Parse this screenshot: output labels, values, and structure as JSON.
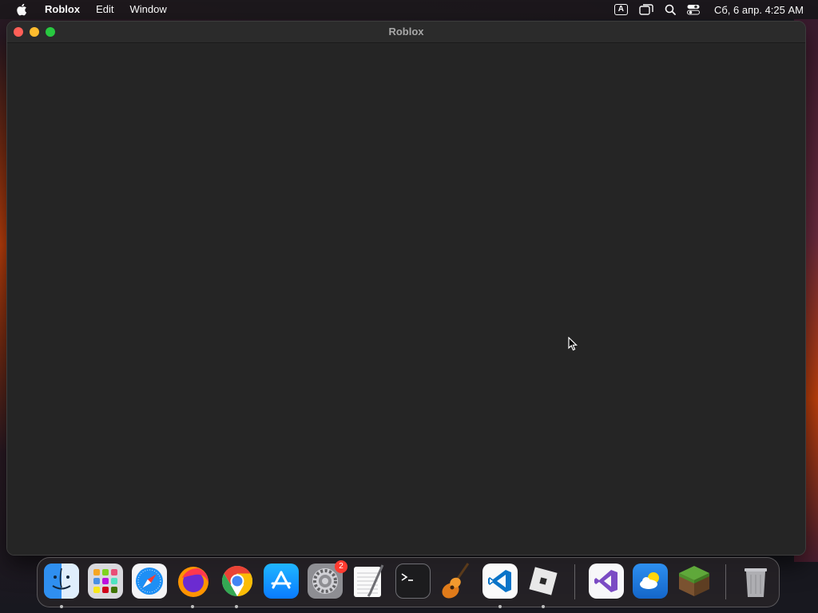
{
  "menubar": {
    "app_name": "Roblox",
    "items": [
      "Edit",
      "Window"
    ],
    "input_source": "A",
    "clock": "Сб, 6 апр.  4:25 AM"
  },
  "window": {
    "title": "Roblox"
  },
  "dock": {
    "system_preferences_badge": "2",
    "apps": [
      {
        "name": "finder",
        "icon": "finder-icon",
        "running": true
      },
      {
        "name": "launchpad",
        "icon": "launchpad-icon",
        "running": false
      },
      {
        "name": "safari",
        "icon": "safari-icon",
        "running": false
      },
      {
        "name": "firefox",
        "icon": "firefox-icon",
        "running": true
      },
      {
        "name": "chrome",
        "icon": "chrome-icon",
        "running": true
      },
      {
        "name": "app-store",
        "icon": "app-store-icon",
        "running": false
      },
      {
        "name": "system-preferences",
        "icon": "gear-icon",
        "running": false
      },
      {
        "name": "textedit",
        "icon": "textedit-icon",
        "running": false
      },
      {
        "name": "terminal",
        "icon": "terminal-icon",
        "running": false
      },
      {
        "name": "garageband",
        "icon": "guitar-icon",
        "running": false
      },
      {
        "name": "vscode",
        "icon": "vscode-icon",
        "running": true
      },
      {
        "name": "roblox",
        "icon": "roblox-icon",
        "running": true
      },
      {
        "name": "visual-studio",
        "icon": "visual-studio-icon",
        "running": false
      },
      {
        "name": "weather",
        "icon": "weather-icon",
        "running": false
      },
      {
        "name": "minecraft",
        "icon": "minecraft-icon",
        "running": false
      },
      {
        "name": "trash",
        "icon": "trash-icon",
        "running": false
      }
    ]
  }
}
